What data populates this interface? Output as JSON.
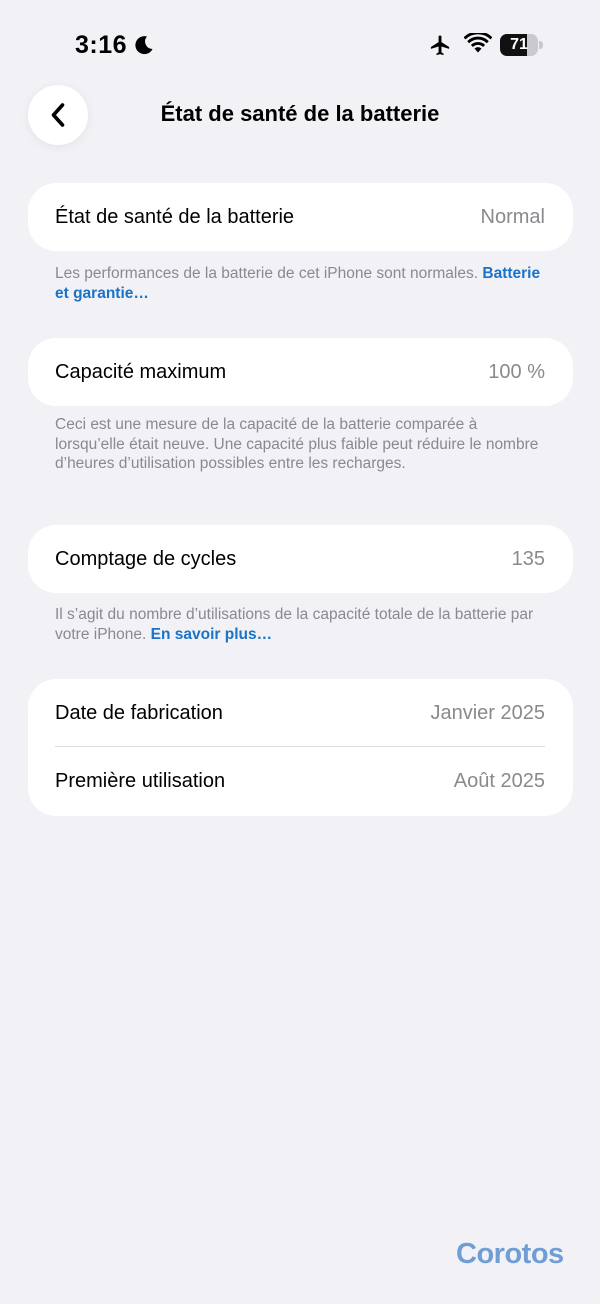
{
  "status_bar": {
    "time": "3:16",
    "battery_level": "71",
    "battery_fraction": 0.71
  },
  "header": {
    "title": "État de santé de la batterie"
  },
  "health": {
    "label": "État de santé de la batterie",
    "value": "Normal",
    "footnote": "Les performances de la batterie de cet iPhone sont normales.",
    "footnote_link": "Batterie et garantie…"
  },
  "capacity": {
    "label": "Capacité maximum",
    "value": "100 %",
    "footnote": "Ceci est une mesure de la capacité de la batterie comparée à lorsqu’elle était neuve. Une capacité plus faible peut réduire le nombre d’heures d’utilisation possibles entre les recharges."
  },
  "cycles": {
    "label": "Comptage de cycles",
    "value": "135",
    "footnote": "Il s’agit du nombre d’utilisations de la capacité totale de la batterie par votre iPhone.",
    "footnote_link": "En savoir plus…"
  },
  "dates": {
    "manufacture_label": "Date de fabrication",
    "manufacture_value": "Janvier 2025",
    "first_use_label": "Première utilisation",
    "first_use_value": "Août 2025"
  },
  "watermark": "Corotos",
  "colors": {
    "background": "#f1f1f6",
    "link": "#1a73c8",
    "secondary_text": "#8a8a8e"
  }
}
